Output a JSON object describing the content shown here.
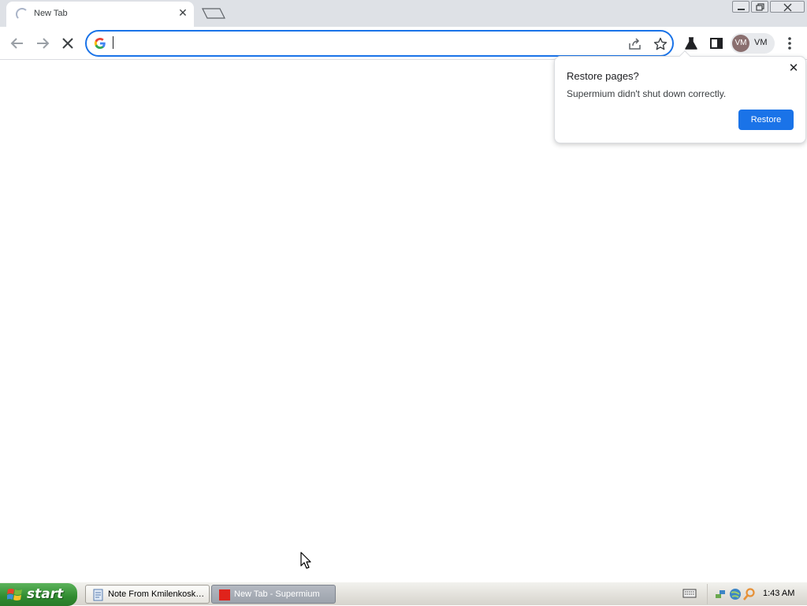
{
  "tab": {
    "title": "New Tab",
    "close_glyph": "✕"
  },
  "toolbar": {
    "omnibox_value": "",
    "profile_initials": "VM",
    "profile_label": "VM"
  },
  "restore_bubble": {
    "title": "Restore pages?",
    "message": "Supermium didn't shut down correctly.",
    "button_label": "Restore",
    "close_glyph": "✕"
  },
  "taskbar": {
    "start_label": "start",
    "tasks": [
      {
        "label": "Note From Kmilenkosk…"
      },
      {
        "label": "New Tab - Supermium"
      }
    ],
    "clock": "1:43 AM"
  },
  "colors": {
    "accent": "#1a73e8",
    "tab_strip": "#dee1e6",
    "start_green": "#2f8b2f"
  },
  "icons": [
    "back-icon",
    "forward-icon",
    "stop-icon",
    "google-g-icon",
    "share-icon",
    "bookmark-star-icon",
    "labs-flask-icon",
    "side-panel-icon",
    "menu-dots-icon",
    "close-icon",
    "windows-logo-icon"
  ]
}
